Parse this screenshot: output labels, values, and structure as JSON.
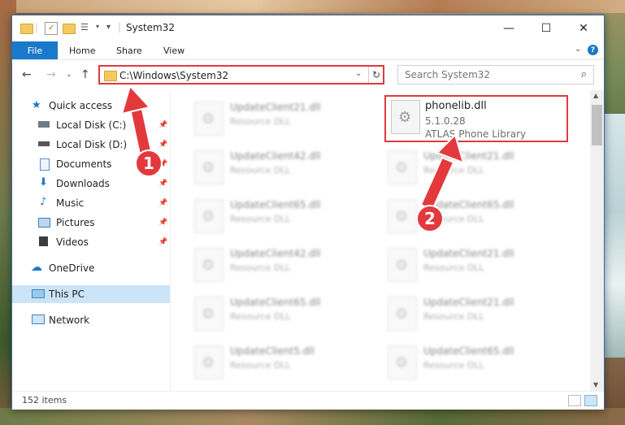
{
  "window": {
    "title": "System32",
    "controls": {
      "minimize": "—",
      "maximize": "☐",
      "close": "✕"
    }
  },
  "ribbon": {
    "file": "File",
    "tabs": [
      "Home",
      "Share",
      "View"
    ],
    "help": "?"
  },
  "address": {
    "path": "C:\\Windows\\System32",
    "search_placeholder": "Search System32"
  },
  "sidebar": {
    "items": [
      {
        "label": "Quick access",
        "icon": "star-icon",
        "pinned": false
      },
      {
        "label": "Local Disk (C:)",
        "icon": "disk-icon",
        "pinned": true
      },
      {
        "label": "Local Disk (D:)",
        "icon": "disk-icon",
        "pinned": true
      },
      {
        "label": "Documents",
        "icon": "documents-icon",
        "pinned": true
      },
      {
        "label": "Downloads",
        "icon": "downloads-icon",
        "pinned": true
      },
      {
        "label": "Music",
        "icon": "music-icon",
        "pinned": true
      },
      {
        "label": "Pictures",
        "icon": "pictures-icon",
        "pinned": true
      },
      {
        "label": "Videos",
        "icon": "videos-icon",
        "pinned": true
      },
      {
        "label": "OneDrive",
        "icon": "onedrive-icon",
        "pinned": false
      },
      {
        "label": "This PC",
        "icon": "this-pc-icon",
        "pinned": false,
        "selected": true
      },
      {
        "label": "Network",
        "icon": "network-icon",
        "pinned": false
      }
    ]
  },
  "files": {
    "left_column": [
      {
        "name": "UpdateClient21.dll",
        "type": "Resource DLL"
      },
      {
        "name": "UpdateClient42.dll",
        "type": "Resource DLL"
      },
      {
        "name": "UpdateClient65.dll",
        "type": "Resource DLL"
      },
      {
        "name": "UpdateClient42.dll",
        "type": "Resource DLL"
      },
      {
        "name": "UpdateClient65.dll",
        "type": "Resource DLL"
      },
      {
        "name": "UpdateClient5.dll",
        "type": "Resource DLL"
      }
    ],
    "highlighted": {
      "name": "phonelib.dll",
      "version": "5.1.0.28",
      "description": "ATLAS Phone Library"
    },
    "right_column": [
      {
        "name": "UpdateClient21.dll",
        "type": "Resource DLL"
      },
      {
        "name": "UpdateClient65.dll",
        "type": "Resource DLL"
      },
      {
        "name": "UpdateClient21.dll",
        "type": "Resource DLL"
      },
      {
        "name": "UpdateClient21.dll",
        "type": "Resource DLL"
      },
      {
        "name": "UpdateClient65.dll",
        "type": "Resource DLL"
      }
    ]
  },
  "status": {
    "count": "152 items"
  },
  "annotations": {
    "step1": "1",
    "step2": "2",
    "color": "#e3393d"
  }
}
